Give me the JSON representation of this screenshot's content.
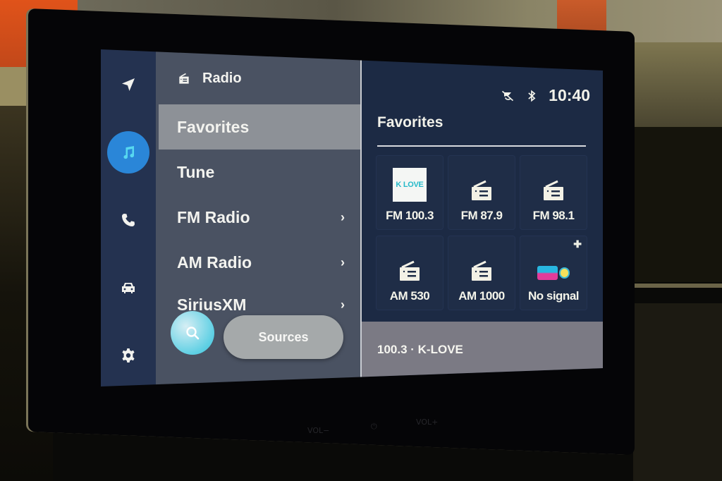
{
  "rail": {
    "items": [
      {
        "name": "navigation",
        "icon": "navigation-arrow-icon",
        "active": false
      },
      {
        "name": "media",
        "icon": "music-note-icon",
        "active": true
      },
      {
        "name": "phone",
        "icon": "phone-icon",
        "active": false
      },
      {
        "name": "vehicle",
        "icon": "car-icon",
        "active": false
      },
      {
        "name": "settings",
        "icon": "gear-icon",
        "active": false
      }
    ],
    "active_color": "#2a86d8"
  },
  "menu": {
    "header": {
      "icon": "radio-icon",
      "title": "Radio"
    },
    "items": [
      {
        "label": "Favorites",
        "selected": true,
        "has_submenu": false
      },
      {
        "label": "Tune",
        "selected": false,
        "has_submenu": false
      },
      {
        "label": "FM Radio",
        "selected": false,
        "has_submenu": true
      },
      {
        "label": "AM Radio",
        "selected": false,
        "has_submenu": true
      },
      {
        "label": "SiriusXM",
        "selected": false,
        "has_submenu": true
      }
    ],
    "chevron": "›",
    "search_button": {
      "icon": "search-icon"
    },
    "sources_button": {
      "label": "Sources"
    }
  },
  "status_bar": {
    "icons": [
      "voice-muted-icon",
      "bluetooth-icon"
    ],
    "time": "10:40"
  },
  "favorites": {
    "title": "Favorites",
    "tiles": [
      {
        "label": "FM 100.3",
        "art": "logo",
        "logo_text": "K LOVE"
      },
      {
        "label": "FM 87.9",
        "art": "radio-icon"
      },
      {
        "label": "FM 98.1",
        "art": "radio-icon"
      },
      {
        "label": "AM 530",
        "art": "radio-icon"
      },
      {
        "label": "AM 1000",
        "art": "radio-icon"
      },
      {
        "label": "No signal",
        "art": "station-logo",
        "extra_icon": "add-icon"
      }
    ]
  },
  "now_playing": {
    "text": "100.3 · K-LOVE"
  },
  "hardware": {
    "vol_down": "VOL−",
    "vol_up": "VOL+"
  }
}
